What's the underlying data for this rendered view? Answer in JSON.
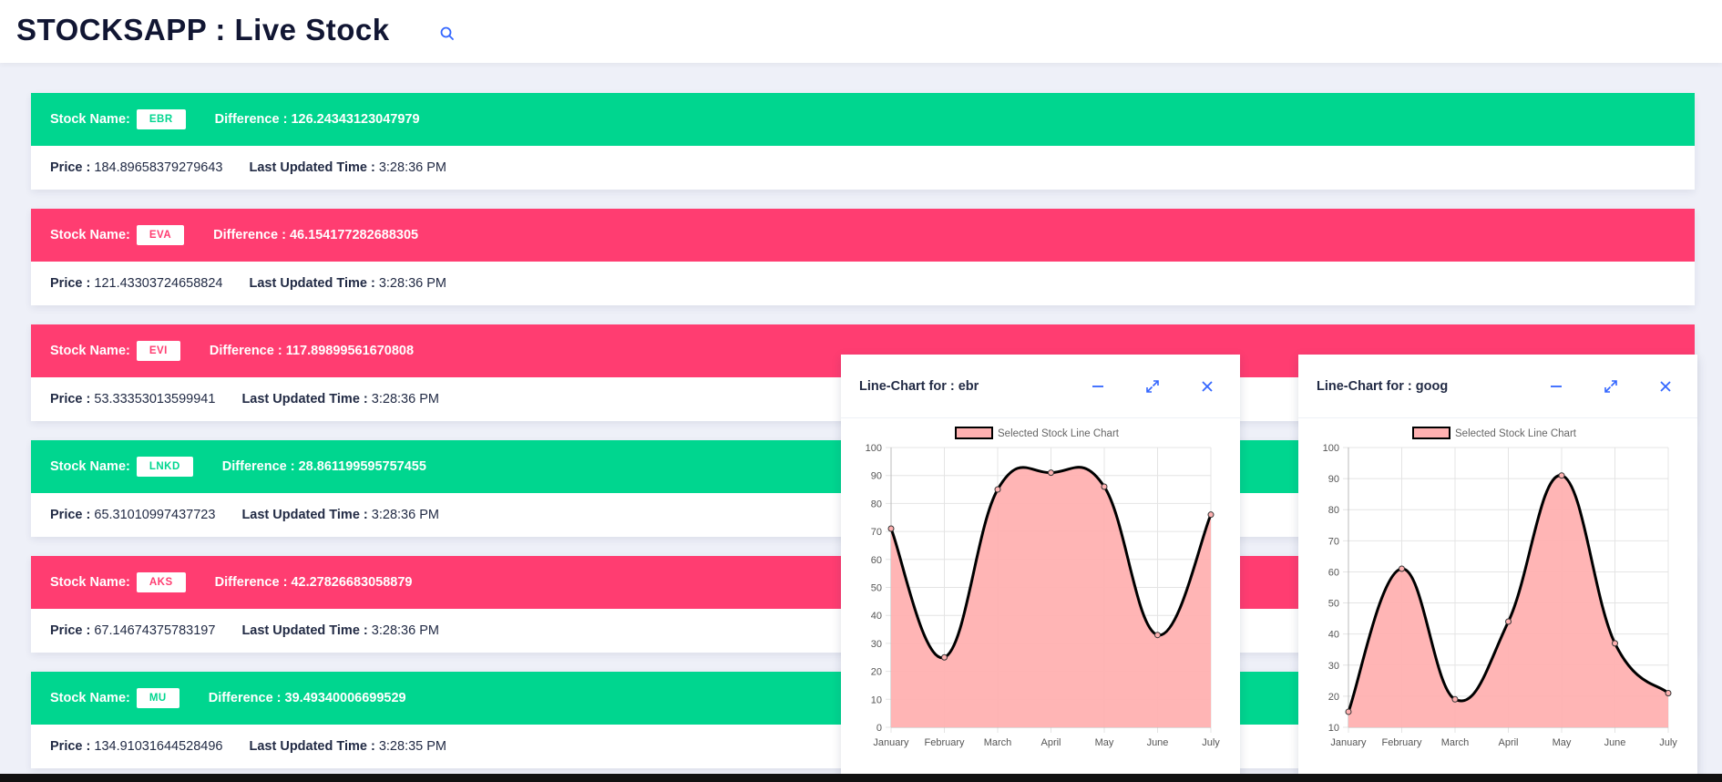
{
  "header": {
    "title": "STOCKSAPP : Live Stock",
    "search_icon": "search-icon"
  },
  "labels": {
    "stock_name": "Stock Name:",
    "difference": "Difference :",
    "price": "Price :",
    "last_updated": "Last Updated Time :"
  },
  "stocks": [
    {
      "name": "EBR",
      "difference": "126.24343123047979",
      "price": "184.89658379279643",
      "time": "3:28:36 PM",
      "trend": "up"
    },
    {
      "name": "EVA",
      "difference": "46.154177282688305",
      "price": "121.43303724658824",
      "time": "3:28:36 PM",
      "trend": "down"
    },
    {
      "name": "EVI",
      "difference": "117.89899561670808",
      "price": "53.33353013599941",
      "time": "3:28:36 PM",
      "trend": "down"
    },
    {
      "name": "LNKD",
      "difference": "28.861199595757455",
      "price": "65.31010997437723",
      "time": "3:28:36 PM",
      "trend": "up"
    },
    {
      "name": "AKS",
      "difference": "42.27826683058879",
      "price": "67.14674375783197",
      "time": "3:28:36 PM",
      "trend": "down"
    },
    {
      "name": "MU",
      "difference": "39.49340006699529",
      "price": "134.91031644528496",
      "time": "3:28:35 PM",
      "trend": "up"
    }
  ],
  "colors": {
    "up": "#00d68f",
    "down": "#ff3d71",
    "accent": "#3366ff",
    "chart_fill": "#ffb1b1",
    "chart_line": "#000000"
  },
  "chart_panels": [
    {
      "title": "Line-Chart for : ebr",
      "controls": [
        "minimize-icon",
        "expand-icon",
        "close-icon"
      ],
      "chart_data": {
        "type": "area",
        "categories": [
          "January",
          "February",
          "March",
          "April",
          "May",
          "June",
          "July"
        ],
        "series": [
          {
            "name": "Selected Stock Line Chart",
            "values": [
              71,
              25,
              85,
              91,
              86,
              33,
              76
            ]
          }
        ],
        "ylim": [
          0,
          100
        ],
        "yticks": [
          0,
          10,
          20,
          30,
          40,
          50,
          60,
          70,
          80,
          90,
          100
        ],
        "legend": "top-center",
        "grid": true
      }
    },
    {
      "title": "Line-Chart for : goog",
      "controls": [
        "minimize-icon",
        "expand-icon",
        "close-icon"
      ],
      "chart_data": {
        "type": "area",
        "categories": [
          "January",
          "February",
          "March",
          "April",
          "May",
          "June",
          "July"
        ],
        "series": [
          {
            "name": "Selected Stock Line Chart",
            "values": [
              15,
              61,
              19,
              44,
              91,
              37,
              21
            ]
          }
        ],
        "ylim": [
          10,
          100
        ],
        "yticks": [
          10,
          20,
          30,
          40,
          50,
          60,
          70,
          80,
          90,
          100
        ],
        "legend": "top-center",
        "grid": true
      }
    }
  ]
}
